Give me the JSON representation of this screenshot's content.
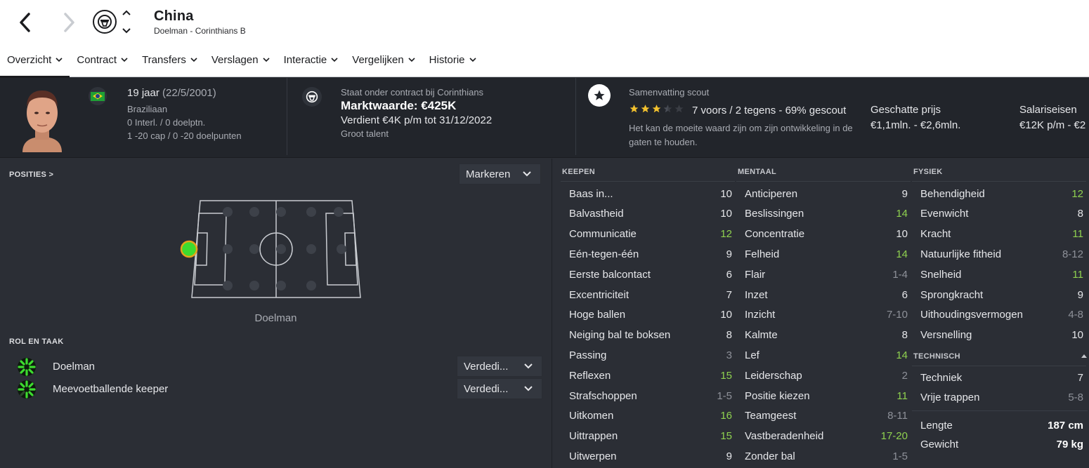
{
  "header": {
    "name": "China",
    "subtitle": "Doelman - Corinthians B"
  },
  "tabs": [
    {
      "label": "Overzicht"
    },
    {
      "label": "Contract"
    },
    {
      "label": "Transfers"
    },
    {
      "label": "Verslagen"
    },
    {
      "label": "Interactie"
    },
    {
      "label": "Vergelijken"
    },
    {
      "label": "Historie"
    }
  ],
  "info": {
    "age": "19 jaar",
    "dob": "(22/5/2001)",
    "nationality": "Braziliaan",
    "caps_line": "0 Interl. / 0 doelptn.",
    "u20_line": "1 -20 cap / 0 -20 doelpunten",
    "contract_status": "Staat onder contract bij Corinthians",
    "market_value": "Marktwaarde: €425K",
    "wage": "Verdient €4K p/m tot 31/12/2022",
    "talent": "Groot talent",
    "scout_title": "Samenvatting scout",
    "scout_rating": 3.5,
    "scout_summary": "7 voors / 2 tegens - 69% gescout",
    "scout_text": "Het kan de moeite waard zijn om zijn ontwikkeling in de gaten te houden.",
    "est_price_label": "Geschatte prijs",
    "est_price_value": "€1,1mln. - €2,6mln.",
    "salary_label": "Salariseisen",
    "salary_value": "€12K p/m - €2"
  },
  "positions": {
    "header": "POSITIES >",
    "highlight_label": "Markeren",
    "position_label": "Doelman"
  },
  "roles": {
    "header": "ROL EN TAAK",
    "items": [
      {
        "name": "Doelman",
        "duty": "Verdedi..."
      },
      {
        "name": "Meevoetballende keeper",
        "duty": "Verdedi..."
      }
    ]
  },
  "attributes": {
    "keepen": {
      "header": "KEEPEN",
      "rows": [
        {
          "label": "Baas in...",
          "value": "10"
        },
        {
          "label": "Balvastheid",
          "value": "10"
        },
        {
          "label": "Communicatie",
          "value": "12"
        },
        {
          "label": "Eén-tegen-één",
          "value": "9"
        },
        {
          "label": "Eerste balcontact",
          "value": "6"
        },
        {
          "label": "Excentriciteit",
          "value": "7"
        },
        {
          "label": "Hoge ballen",
          "value": "10"
        },
        {
          "label": "Neiging bal te boksen",
          "value": "8"
        },
        {
          "label": "Passing",
          "value": "3"
        },
        {
          "label": "Reflexen",
          "value": "15"
        },
        {
          "label": "Strafschoppen",
          "value": "1-5"
        },
        {
          "label": "Uitkomen",
          "value": "16"
        },
        {
          "label": "Uittrappen",
          "value": "15"
        },
        {
          "label": "Uitwerpen",
          "value": "9"
        }
      ]
    },
    "mentaal": {
      "header": "MENTAAL",
      "rows": [
        {
          "label": "Anticiperen",
          "value": "9"
        },
        {
          "label": "Beslissingen",
          "value": "14"
        },
        {
          "label": "Concentratie",
          "value": "10"
        },
        {
          "label": "Felheid",
          "value": "14"
        },
        {
          "label": "Flair",
          "value": "1-4"
        },
        {
          "label": "Inzet",
          "value": "6"
        },
        {
          "label": "Inzicht",
          "value": "7-10"
        },
        {
          "label": "Kalmte",
          "value": "8"
        },
        {
          "label": "Lef",
          "value": "14"
        },
        {
          "label": "Leiderschap",
          "value": "2"
        },
        {
          "label": "Positie kiezen",
          "value": "11"
        },
        {
          "label": "Teamgeest",
          "value": "8-11"
        },
        {
          "label": "Vastberadenheid",
          "value": "17-20"
        },
        {
          "label": "Zonder bal",
          "value": "1-5"
        }
      ]
    },
    "fysiek": {
      "header": "FYSIEK",
      "rows": [
        {
          "label": "Behendigheid",
          "value": "12"
        },
        {
          "label": "Evenwicht",
          "value": "8"
        },
        {
          "label": "Kracht",
          "value": "11"
        },
        {
          "label": "Natuurlijke fitheid",
          "value": "8-12"
        },
        {
          "label": "Snelheid",
          "value": "11"
        },
        {
          "label": "Sprongkracht",
          "value": "9"
        },
        {
          "label": "Uithoudingsvermogen",
          "value": "4-8"
        },
        {
          "label": "Versnelling",
          "value": "10"
        }
      ]
    },
    "technisch": {
      "header": "TECHNISCH",
      "rows": [
        {
          "label": "Techniek",
          "value": "7"
        },
        {
          "label": "Vrije trappen",
          "value": "5-8"
        }
      ]
    },
    "body": [
      {
        "label": "Lengte",
        "value": "187 cm"
      },
      {
        "label": "Gewicht",
        "value": "79 kg"
      }
    ]
  },
  "colors": {
    "high": "#8fd14f",
    "mid": "#e6e7ea",
    "low": "#8e9199",
    "position_dot": "#3ddc2f"
  }
}
